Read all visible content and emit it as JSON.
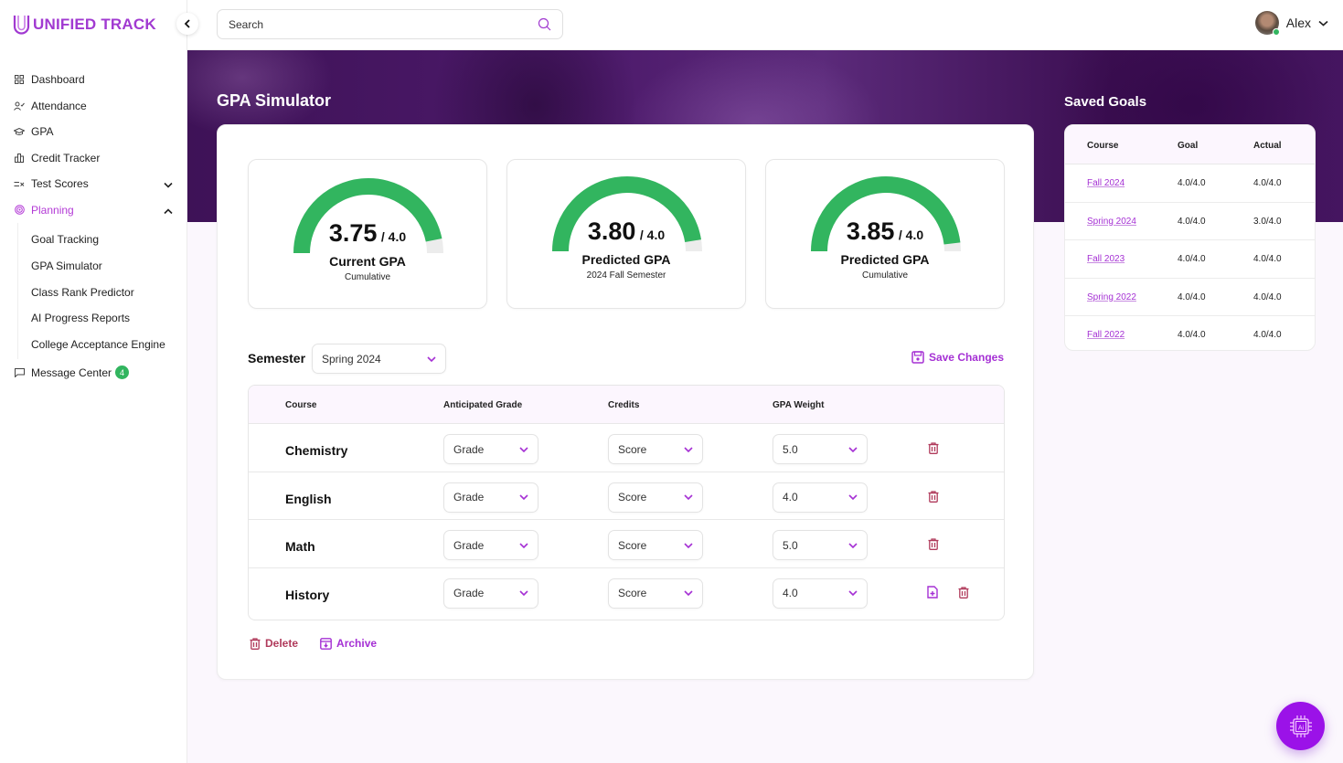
{
  "app": {
    "name": "UNIFIED TRACK",
    "brand_color": "#a13ad1",
    "accent_color": "#a530d4",
    "success_color": "#32b55f",
    "danger_color": "#b03a5b"
  },
  "sidebar": {
    "items": [
      {
        "label": "Dashboard",
        "icon": "dashboard-icon"
      },
      {
        "label": "Attendance",
        "icon": "attendance-icon"
      },
      {
        "label": "GPA",
        "icon": "graduation-cap-icon"
      },
      {
        "label": "Credit Tracker",
        "icon": "bar-chart-icon"
      },
      {
        "label": "Test Scores",
        "icon": "test-scores-icon",
        "expandable": true,
        "expanded": false
      },
      {
        "label": "Planning",
        "icon": "target-icon",
        "expandable": true,
        "expanded": true,
        "active": true
      }
    ],
    "planning_children": [
      {
        "label": "Goal Tracking"
      },
      {
        "label": "GPA Simulator"
      },
      {
        "label": "Class Rank Predictor"
      },
      {
        "label": "AI Progress Reports"
      },
      {
        "label": "College Acceptance Engine"
      }
    ],
    "message_center": {
      "label": "Message Center",
      "badge": "4"
    }
  },
  "topbar": {
    "search_placeholder": "Search",
    "user_name": "Alex"
  },
  "page": {
    "title": "GPA Simulator",
    "gauges": [
      {
        "value": "3.75",
        "max": "/ 4.0",
        "fraction": 0.9375,
        "label": "Current GPA",
        "sublabel": "Cumulative"
      },
      {
        "value": "3.80",
        "max": "/ 4.0",
        "fraction": 0.95,
        "label": "Predicted GPA",
        "sublabel": "2024 Fall Semester"
      },
      {
        "value": "3.85",
        "max": "/ 4.0",
        "fraction": 0.9625,
        "label": "Predicted GPA",
        "sublabel": "Cumulative"
      }
    ],
    "semester": {
      "label": "Semester",
      "selected": "Spring 2024"
    },
    "save_label": "Save Changes",
    "table": {
      "headers": [
        "Course",
        "Anticipated Grade",
        "Credits",
        "GPA Weight"
      ],
      "rows": [
        {
          "course": "Chemistry",
          "grade": "Grade",
          "credits": "Score",
          "weight": "5.0",
          "has_add": false
        },
        {
          "course": "English",
          "grade": "Grade",
          "credits": "Score",
          "weight": "4.0",
          "has_add": false
        },
        {
          "course": "Math",
          "grade": "Grade",
          "credits": "Score",
          "weight": "5.0",
          "has_add": false
        },
        {
          "course": "History",
          "grade": "Grade",
          "credits": "Score",
          "weight": "4.0",
          "has_add": true
        }
      ]
    },
    "actions": {
      "delete_label": "Delete",
      "archive_label": "Archive"
    }
  },
  "saved_goals": {
    "title": "Saved Goals",
    "headers": [
      "Course",
      "Goal",
      "Actual"
    ],
    "rows": [
      {
        "course": "Fall 2024",
        "goal": "4.0/4.0",
        "actual": "4.0/4.0"
      },
      {
        "course": "Spring 2024",
        "goal": "4.0/4.0",
        "actual": "3.0/4.0"
      },
      {
        "course": "Fall 2023",
        "goal": "4.0/4.0",
        "actual": "4.0/4.0"
      },
      {
        "course": "Spring 2022",
        "goal": "4.0/4.0",
        "actual": "4.0/4.0"
      },
      {
        "course": "Fall 2022",
        "goal": "4.0/4.0",
        "actual": "4.0/4.0"
      }
    ]
  },
  "ai_fab": {
    "label": "Ai",
    "icon": "ai-chip-icon"
  }
}
